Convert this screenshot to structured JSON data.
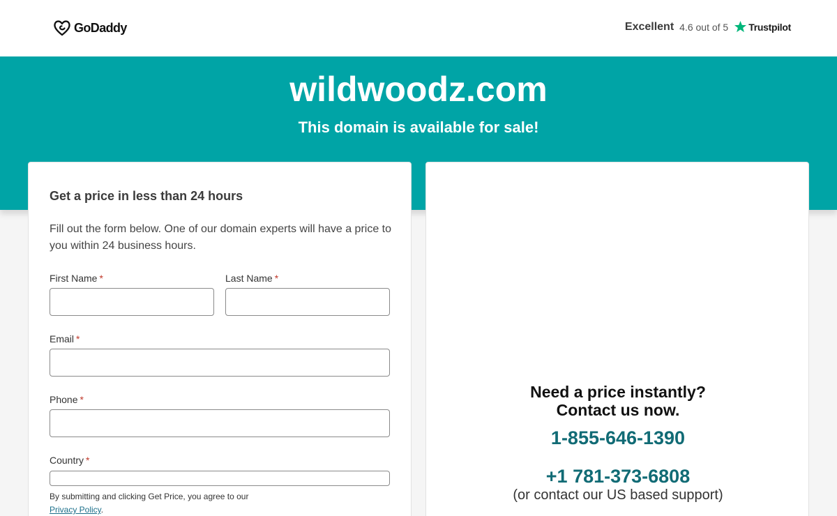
{
  "header": {
    "logo_text": "GoDaddy",
    "rating_word": "Excellent",
    "rating_score": "4.6 out of 5",
    "trustpilot_label": "Trustpilot"
  },
  "hero": {
    "domain": "wildwoodz.com",
    "subtitle": "This domain is available for sale!"
  },
  "form": {
    "title": "Get a price in less than 24 hours",
    "description": "Fill out the form below. One of our domain experts will have a price to you within 24 business hours.",
    "required_mark": "*",
    "fields": {
      "first_name": {
        "label": "First Name",
        "value": ""
      },
      "last_name": {
        "label": "Last Name",
        "value": ""
      },
      "email": {
        "label": "Email",
        "value": ""
      },
      "phone": {
        "label": "Phone",
        "value": ""
      },
      "country": {
        "label": "Country",
        "value": ""
      }
    },
    "legal_text": "By submitting and clicking Get Price, you agree to our",
    "privacy_link": "Privacy Policy",
    "legal_end": "."
  },
  "contact": {
    "question_line1": "Need a price instantly?",
    "question_line2": "Contact us now.",
    "phone_1": "1-855-646-1390",
    "phone_2": "+1 781-373-6808",
    "support_note": "(or contact our US based support)"
  },
  "colors": {
    "teal_band": "#00a4a6",
    "phone_text": "#116b75",
    "trustpilot_green": "#00b67a",
    "required": "#c0392b"
  }
}
